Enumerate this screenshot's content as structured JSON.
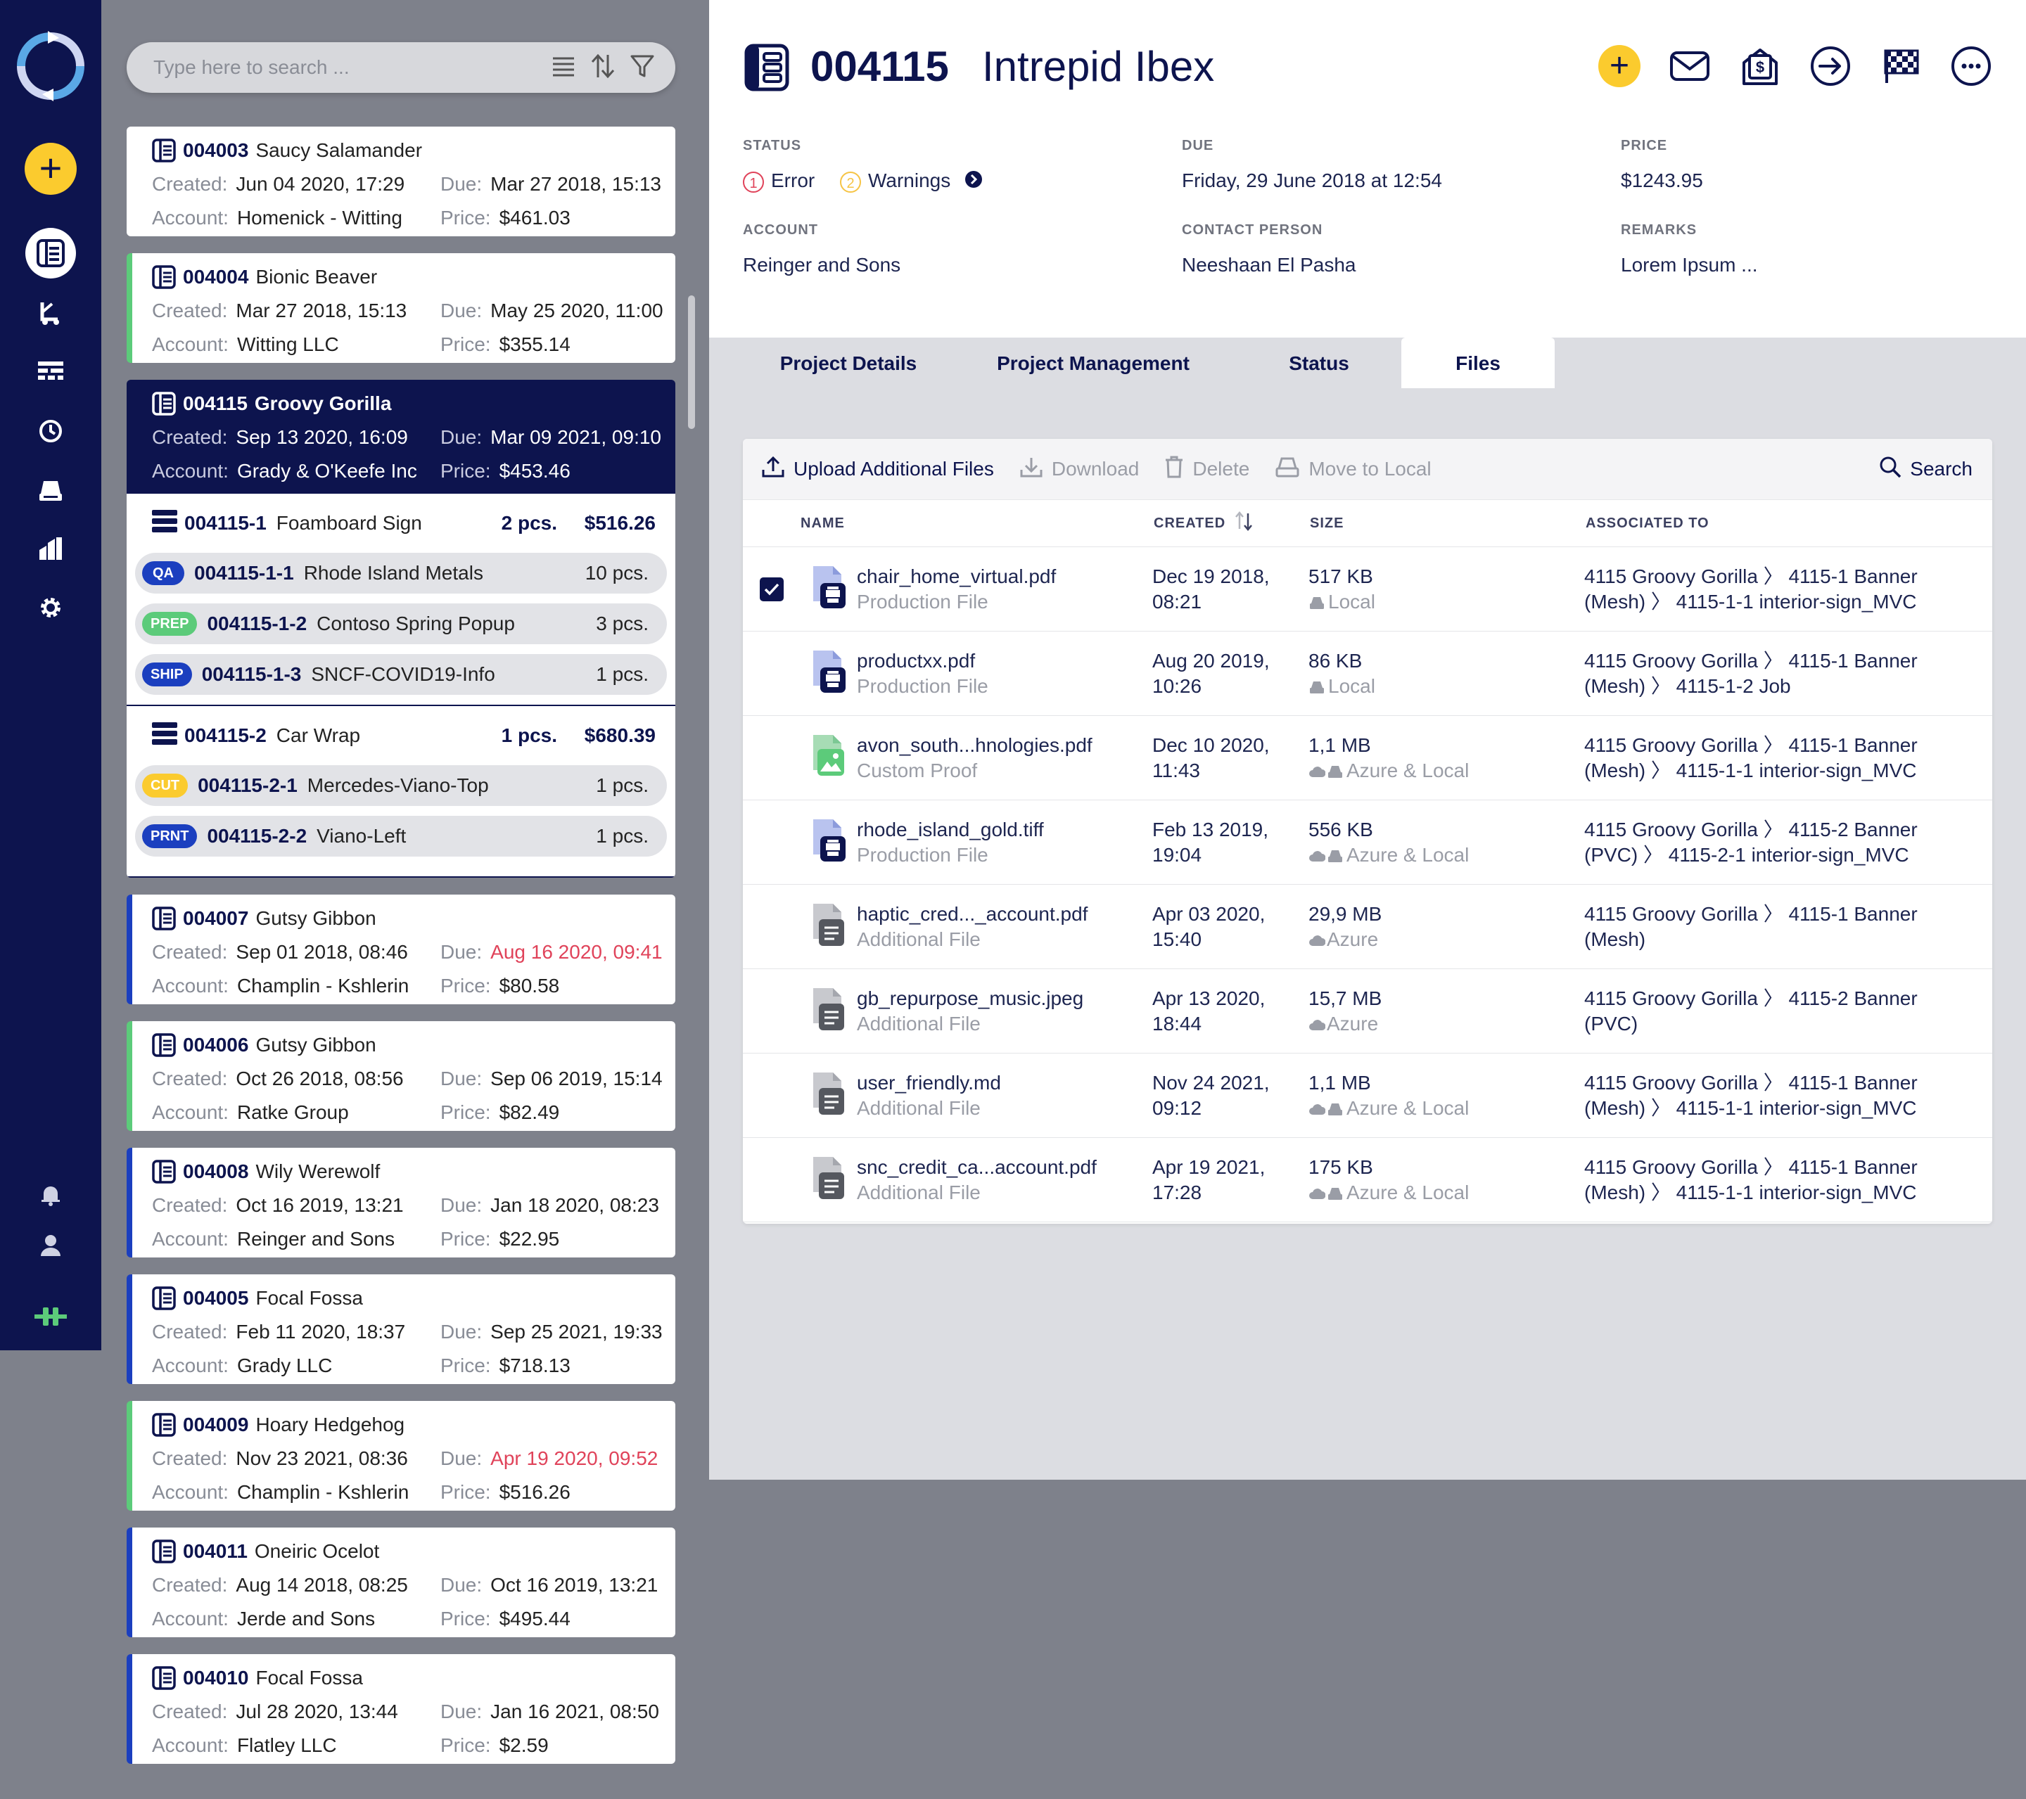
{
  "search": {
    "placeholder": "Type here to search ..."
  },
  "orders": [
    {
      "id": "004003",
      "name": "Saucy Salamander",
      "created": "Jun 04 2020, 17:29",
      "due": "Mar 27 2018, 15:13",
      "account": "Homenick - Witting",
      "price": "$461.03"
    },
    {
      "id": "004004",
      "name": "Bionic Beaver",
      "created": "Mar 27 2018, 15:13",
      "due": "May 25 2020, 11:00",
      "account": "Witting LLC",
      "price": "$355.14"
    },
    {
      "id": "004115",
      "name": "Groovy Gorilla",
      "created": "Sep 13 2020, 16:09",
      "due": "Mar 09 2021, 09:10",
      "account": "Grady & O'Keefe Inc",
      "price": "$453.46"
    },
    {
      "id": "004007",
      "name": "Gutsy Gibbon",
      "created": "Sep 01 2018, 08:46",
      "due": "Aug 16 2020, 09:41",
      "account": "Champlin - Kshlerin",
      "price": "$80.58"
    },
    {
      "id": "004006",
      "name": "Gutsy Gibbon",
      "created": "Oct 26 2018, 08:56",
      "due": "Sep 06 2019, 15:14",
      "account": "Ratke Group",
      "price": "$82.49"
    },
    {
      "id": "004008",
      "name": "Wily Werewolf",
      "created": "Oct 16 2019, 13:21",
      "due": "Jan 18 2020, 08:23",
      "account": "Reinger and Sons",
      "price": "$22.95"
    },
    {
      "id": "004005",
      "name": "Focal Fossa",
      "created": "Feb 11 2020, 18:37",
      "due": "Sep 25 2021, 19:33",
      "account": "Grady LLC",
      "price": "$718.13"
    },
    {
      "id": "004009",
      "name": "Hoary Hedgehog",
      "created": "Nov 23 2021, 08:36",
      "due": "Apr 19 2020, 09:52",
      "account": "Champlin - Kshlerin",
      "price": "$516.26"
    },
    {
      "id": "004011",
      "name": "Oneiric Ocelot",
      "created": "Aug 14 2018, 08:25",
      "due": "Oct 16 2019, 13:21",
      "account": "Jerde and Sons",
      "price": "$495.44"
    },
    {
      "id": "004010",
      "name": "Focal Fossa",
      "created": "Jul 28 2020, 13:44",
      "due": "Jan 16 2021, 08:50",
      "account": "Flatley LLC",
      "price": "$2.59"
    }
  ],
  "labels": {
    "created": "Created:",
    "due": "Due:",
    "account": "Account:",
    "price": "Price:"
  },
  "line_items": [
    {
      "id": "004115-1",
      "name": "Foamboard Sign",
      "qty": "2 pcs.",
      "amount": "$516.26",
      "subs": [
        {
          "tag": "QA",
          "tag_color": "#1b3fbf",
          "id": "004115-1-1",
          "name": "Rhode Island Metals",
          "qty": "10 pcs."
        },
        {
          "tag": "PREP",
          "tag_color": "#5ccb7a",
          "id": "004115-1-2",
          "name": "Contoso Spring Popup",
          "qty": "3 pcs."
        },
        {
          "tag": "SHIP",
          "tag_color": "#1b3fbf",
          "id": "004115-1-3",
          "name": "SNCF-COVID19-Info",
          "qty": "1 pcs."
        }
      ]
    },
    {
      "id": "004115-2",
      "name": "Car Wrap",
      "qty": "1 pcs.",
      "amount": "$680.39",
      "subs": [
        {
          "tag": "CUT",
          "tag_color": "#fbcb2e",
          "id": "004115-2-1",
          "name": "Mercedes-Viano-Top",
          "qty": "1 pcs."
        },
        {
          "tag": "PRNT",
          "tag_color": "#1b3fbf",
          "id": "004115-2-2",
          "name": "Viano-Left",
          "qty": "1 pcs."
        }
      ]
    }
  ],
  "detail": {
    "id": "004115",
    "name": "Intrepid Ibex",
    "status_label": "STATUS",
    "error_count": "1",
    "error_text": "Error",
    "warning_count": "2",
    "warning_text": "Warnings",
    "due_label": "DUE",
    "due": "Friday, 29 June 2018 at 12:54",
    "price_label": "PRICE",
    "price": "$1243.95",
    "account_label": "ACCOUNT",
    "account": "Reinger and Sons",
    "contact_label": "CONTACT PERSON",
    "contact": "Neeshaan El Pasha",
    "remarks_label": "REMARKS",
    "remarks": "Lorem Ipsum ..."
  },
  "tabs": [
    "Project Details",
    "Project Management",
    "Status",
    "Files"
  ],
  "active_tab": "Files",
  "toolbar": {
    "upload": "Upload Additional Files",
    "download": "Download",
    "delete": "Delete",
    "move": "Move to Local",
    "search": "Search"
  },
  "table_headers": {
    "name": "NAME",
    "created": "CREATED",
    "size": "SIZE",
    "associated": "ASSOCIATED TO"
  },
  "files": [
    {
      "name": "chair_home_virtual.pdf",
      "type": "Production File",
      "date": "Dec 19 2018,",
      "time": "08:21",
      "size": "517 KB",
      "storage": "Local",
      "assoc1": "4115 Groovy Gorilla  〉 4115-1 Banner",
      "assoc2": "(Mesh)  〉 4115-1-1 interior-sign_MVC",
      "checked": true,
      "icon": "production"
    },
    {
      "name": "productxx.pdf",
      "type": "Production File",
      "date": "Aug 20 2019,",
      "time": "10:26",
      "size": "86 KB",
      "storage": "Local",
      "assoc1": "4115 Groovy Gorilla  〉 4115-1 Banner",
      "assoc2": "(Mesh)  〉 4115-1-2 Job",
      "checked": false,
      "icon": "production"
    },
    {
      "name": "avon_south...hnologies.pdf",
      "type": "Custom Proof",
      "date": "Dec 10 2020,",
      "time": "11:43",
      "size": "1,1 MB",
      "storage": "Azure & Local",
      "assoc1": "4115 Groovy Gorilla  〉 4115-1 Banner",
      "assoc2": "(Mesh)  〉 4115-1-1 interior-sign_MVC",
      "checked": false,
      "icon": "proof"
    },
    {
      "name": "rhode_island_gold.tiff",
      "type": "Production File",
      "date": "Feb 13 2019,",
      "time": "19:04",
      "size": "556 KB",
      "storage": "Azure & Local",
      "assoc1": "4115 Groovy Gorilla  〉 4115-2 Banner",
      "assoc2": "(PVC)  〉 4115-2-1 interior-sign_MVC",
      "checked": false,
      "icon": "production"
    },
    {
      "name": "haptic_cred..._account.pdf",
      "type": "Additional File",
      "date": "Apr 03 2020,",
      "time": "15:40",
      "size": "29,9 MB",
      "storage": "Azure",
      "assoc1": "4115 Groovy Gorilla  〉 4115-1 Banner",
      "assoc2": "(Mesh)",
      "checked": false,
      "icon": "additional"
    },
    {
      "name": "gb_repurpose_music.jpeg",
      "type": "Additional File",
      "date": "Apr 13 2020,",
      "time": "18:44",
      "size": "15,7 MB",
      "storage": "Azure",
      "assoc1": "4115 Groovy Gorilla  〉 4115-2 Banner",
      "assoc2": "(PVC)",
      "checked": false,
      "icon": "additional"
    },
    {
      "name": "user_friendly.md",
      "type": "Additional File",
      "date": "Nov 24 2021,",
      "time": "09:12",
      "size": "1,1 MB",
      "storage": "Azure & Local",
      "assoc1": "4115 Groovy Gorilla  〉 4115-1 Banner",
      "assoc2": "(Mesh)  〉 4115-1-1 interior-sign_MVC",
      "checked": false,
      "icon": "additional"
    },
    {
      "name": "snc_credit_ca...account.pdf",
      "type": "Additional File",
      "date": "Apr 19 2021,",
      "time": "17:28",
      "size": "175 KB",
      "storage": "Azure & Local",
      "assoc1": "4115 Groovy Gorilla  〉 4115-1 Banner",
      "assoc2": "(Mesh)  〉 4115-1-1 interior-sign_MVC",
      "checked": false,
      "icon": "additional"
    }
  ],
  "colors": {
    "navy": "#0d144e",
    "accent_yellow": "#fbcb2e",
    "green": "#5ccb7a",
    "blue": "#1b3fbf",
    "error": "#e0435a",
    "warning": "#f6c445"
  }
}
